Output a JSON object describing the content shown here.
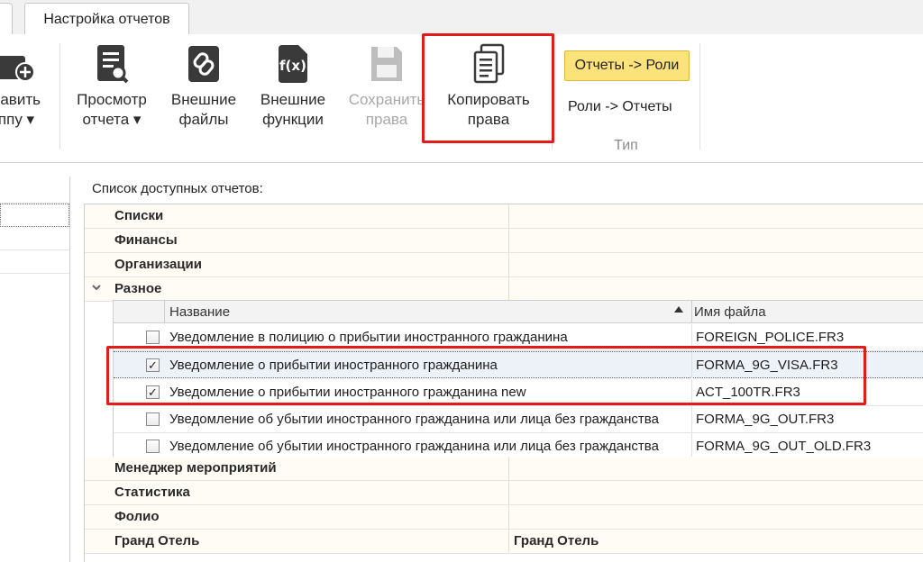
{
  "tabs": {
    "active": "Настройка отчетов"
  },
  "ribbon": {
    "add_group": {
      "line1": "бавить",
      "line2": "ппу ▾"
    },
    "view_report": {
      "line1": "Просмотр",
      "line2": "отчета ▾"
    },
    "external_files": {
      "line1": "Внешние",
      "line2": "файлы"
    },
    "external_functions": {
      "line1": "Внешние",
      "line2": "функции"
    },
    "save_rights": {
      "line1": "Сохранить",
      "line2": "права"
    },
    "copy_rights": {
      "line1": "Копировать",
      "line2": "права"
    },
    "type_group": {
      "selected": "Отчеты -> Роли",
      "option": "Роли -> Отчеты",
      "label": "Тип"
    }
  },
  "list_title": "Список доступных отчетов:",
  "groups": [
    {
      "name": "Списки",
      "value": ""
    },
    {
      "name": "Финансы",
      "value": ""
    },
    {
      "name": "Организации",
      "value": ""
    },
    {
      "name": "Разное",
      "value": ""
    },
    {
      "name": "Менеджер мероприятий",
      "value": ""
    },
    {
      "name": "Статистика",
      "value": ""
    },
    {
      "name": "Фолио",
      "value": ""
    },
    {
      "name": "Гранд Отель",
      "value": "Гранд Отель"
    }
  ],
  "sub_table": {
    "col_name": "Название",
    "col_file": "Имя файла",
    "rows": [
      {
        "name": "Уведомление в полицию о прибытии иностранного гражданина",
        "file": "FOREIGN_POLICE.FR3",
        "checked": false
      },
      {
        "name": "Уведомление о прибытии иностранного гражданина",
        "file": "FORMA_9G_VISA.FR3",
        "checked": true
      },
      {
        "name": "Уведомление о прибытии иностранного гражданина new",
        "file": "ACT_100TR.FR3",
        "checked": true
      },
      {
        "name": "Уведомление об убытии иностранного гражданина или лица без гражданства",
        "file": "FORMA_9G_OUT.FR3",
        "checked": false
      },
      {
        "name": "Уведомление об убытии иностранного гражданина или лица без гражданства",
        "file": "FORMA_9G_OUT_OLD.FR3",
        "checked": false
      }
    ]
  },
  "colors": {
    "highlight": "#e21b1b",
    "selected_type": "#fbe27a"
  }
}
